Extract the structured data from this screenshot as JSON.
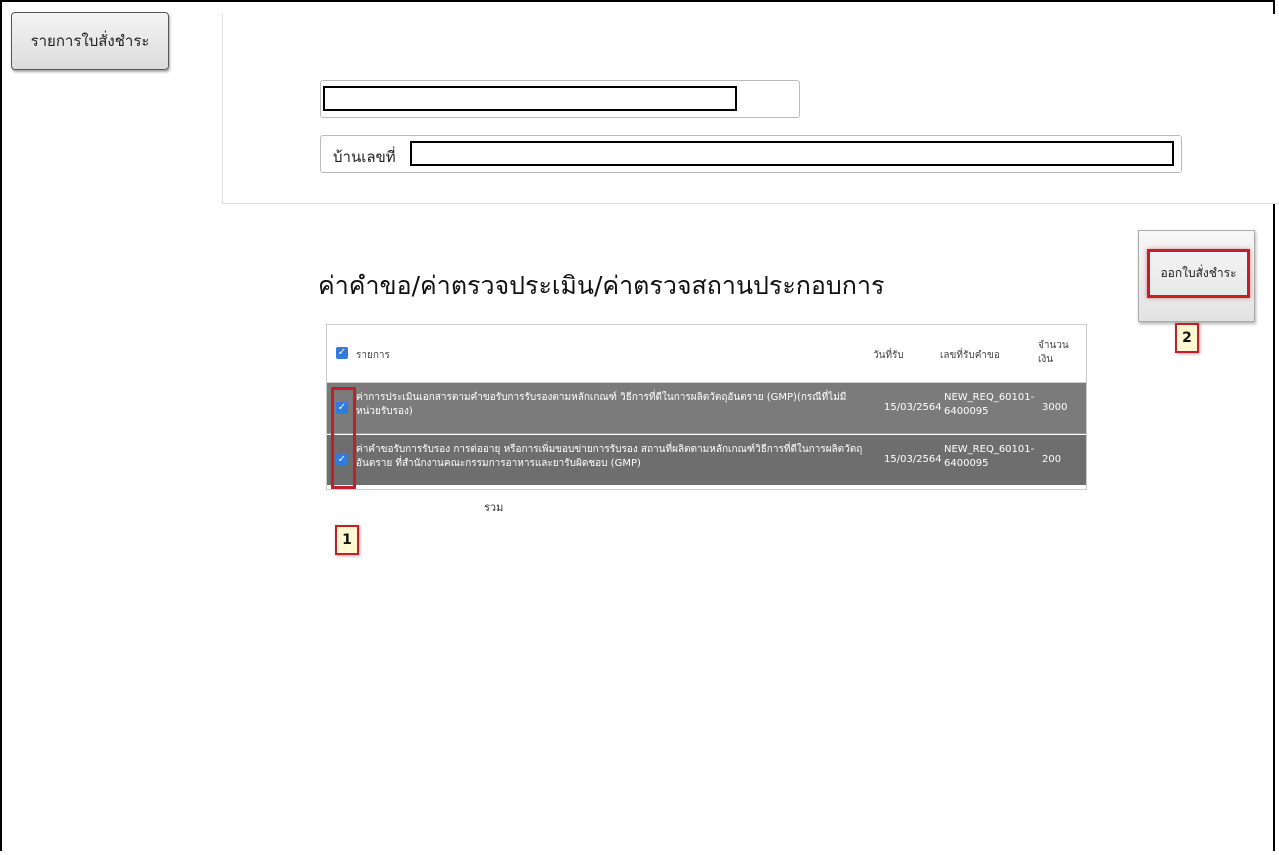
{
  "menu": {
    "label": "รายการใบสั่งชำระ"
  },
  "header": {
    "address_label": "บ้านเลขที่"
  },
  "section": {
    "title": "ค่าคำขอ/ค่าตรวจประเมิน/ค่าตรวจสถานประกอบการ"
  },
  "actions": {
    "issue_label": "ออกใบสั่งชำระ"
  },
  "table": {
    "columns": [
      "รายการ",
      "วันที่รับ",
      "เลขที่รับคำขอ",
      "จำนวนเงิน"
    ],
    "rows": [
      {
        "checked": true,
        "item": "ค่าการประเมินเอกสารตามคำขอรับการรับรองตามหลักเกณฑ์ วิธีการที่ดีในการผลิตวัตถุอันตราย (GMP)(กรณีที่ไม่มีหน่วยรับรอง)",
        "date": "15/03/2564",
        "request_no": "NEW_REQ_60101-6400095",
        "amount": "3000"
      },
      {
        "checked": true,
        "item": "ค่าคำขอรับการรับรอง การต่ออายุ หรือการเพิ่มขอบข่ายการรับรอง สถานที่ผลิตตามหลักเกณฑ์วิธีการที่ดีในการผลิตวัตถุอันตราย ที่สำนักงานคณะกรรมการอาหารและยารับผิดชอบ (GMP)",
        "date": "15/03/2564",
        "request_no": "NEW_REQ_60101-6400095",
        "amount": "200"
      }
    ],
    "total_label": "รวม"
  },
  "callouts": {
    "one": "1",
    "two": "2"
  },
  "colors": {
    "highlight": "#c0202a",
    "row_bg": "#7b7b7b",
    "checkbox": "#2f7be0"
  }
}
